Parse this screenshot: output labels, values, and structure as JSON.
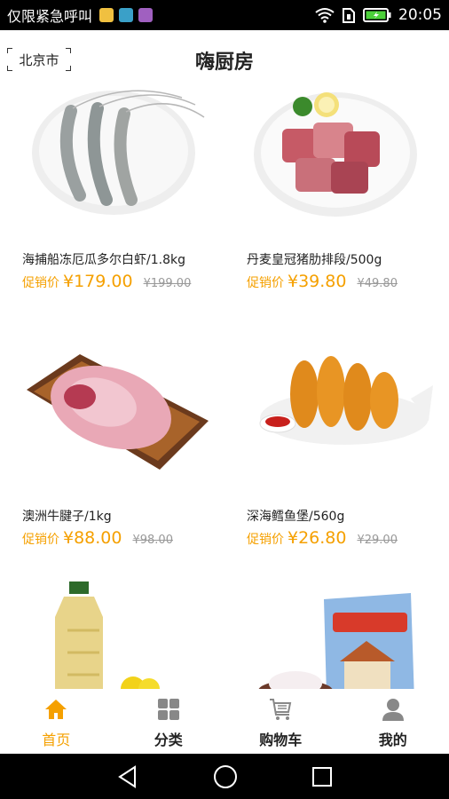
{
  "status": {
    "carrier": "仅限紧急呼叫",
    "time": "20:05"
  },
  "header": {
    "city": "北京市",
    "title": "嗨厨房"
  },
  "products": [
    {
      "name": "海捕船冻厄瓜多尔白虾/1.8kg",
      "price_label": "促销价",
      "price": "¥179.00",
      "original_price": "¥199.00",
      "image": "shrimp-plate"
    },
    {
      "name": "丹麦皇冠猪肋排段/500g",
      "price_label": "促销价",
      "price": "¥39.80",
      "original_price": "¥49.80",
      "image": "pork-ribs-plate"
    },
    {
      "name": "澳洲牛腱子/1kg",
      "price_label": "促销价",
      "price": "¥88.00",
      "original_price": "¥98.00",
      "image": "beef-shank-mat"
    },
    {
      "name": "深海鳕鱼堡/560g",
      "price_label": "促销价",
      "price": "¥26.80",
      "original_price": "¥29.00",
      "image": "fried-fish-plate"
    },
    {
      "name": "",
      "price_label": "",
      "price": "",
      "original_price": "",
      "image": "oil-bottle"
    },
    {
      "name": "",
      "price_label": "",
      "price": "",
      "original_price": "",
      "image": "flour-bag"
    }
  ],
  "tabs": [
    {
      "label": "首页",
      "icon": "home-icon",
      "active": true
    },
    {
      "label": "分类",
      "icon": "category-grid-icon",
      "active": false
    },
    {
      "label": "购物车",
      "icon": "cart-icon",
      "active": false
    },
    {
      "label": "我的",
      "icon": "user-icon",
      "active": false
    }
  ],
  "colors": {
    "accent": "#f5a000",
    "text": "#222222",
    "muted": "#999999",
    "inactive_icon": "#888888"
  }
}
